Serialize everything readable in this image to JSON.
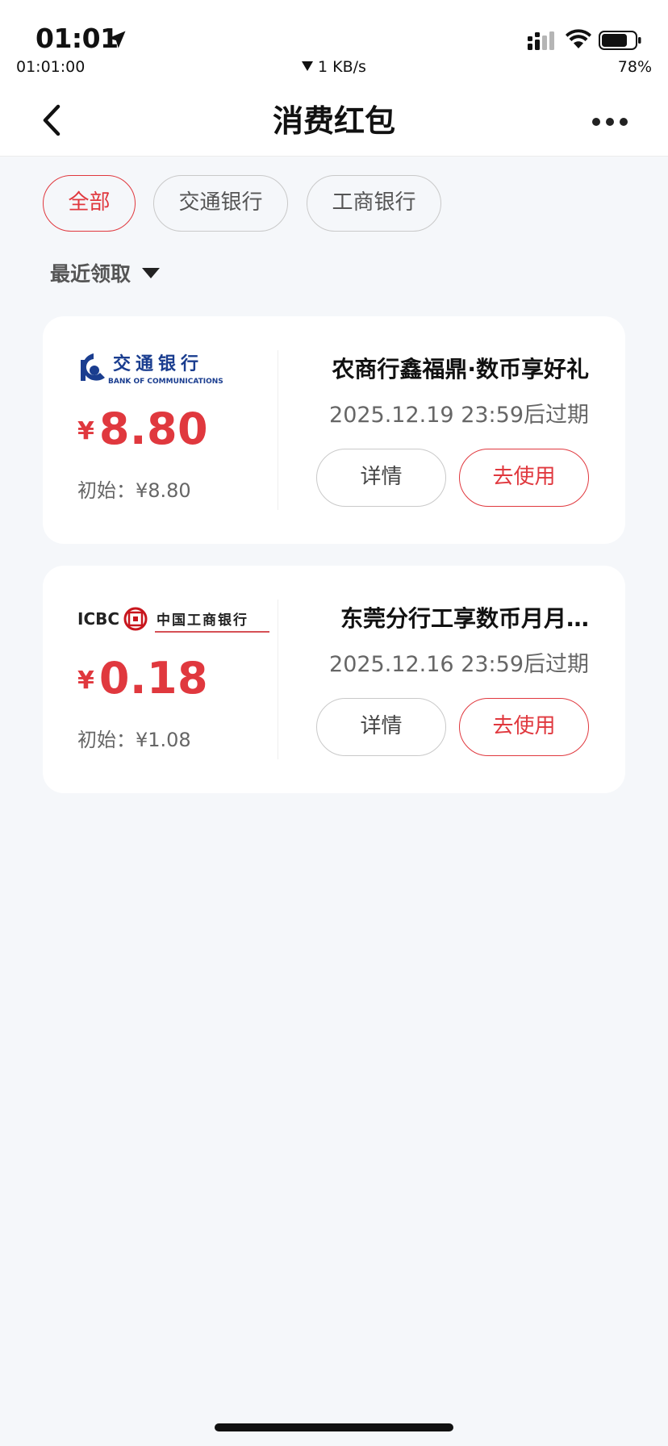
{
  "status_bar": {
    "time": "01:01",
    "sub_time": "01:01:00",
    "net_speed": "1 KB/s",
    "battery": "78%"
  },
  "nav": {
    "title": "消费红包"
  },
  "filters": [
    {
      "label": "全部",
      "active": true
    },
    {
      "label": "交通银行",
      "active": false
    },
    {
      "label": "工商银行",
      "active": false
    }
  ],
  "sort_label": "最近领取",
  "cards": [
    {
      "bank_logo": "bank-of-communications-logo",
      "logo_text_cn": "交通银行",
      "logo_text_en": "BANK OF COMMUNICATIONS",
      "currency": "¥",
      "amount": "8.80",
      "initial": "初始：¥8.80",
      "title": "农商行鑫福鼎·数币享好礼",
      "expiry": "2025.12.19 23:59后过期",
      "detail_label": "详情",
      "use_label": "去使用"
    },
    {
      "bank_logo": "icbc-logo",
      "logo_text_en": "ICBC",
      "logo_text_cn": "中国工商银行",
      "currency": "¥",
      "amount": "0.18",
      "initial": "初始：¥1.08",
      "title": "东莞分行工享数币月月…",
      "expiry": "2025.12.16 23:59后过期",
      "detail_label": "详情",
      "use_label": "去使用"
    }
  ],
  "colors": {
    "accent": "#e0383e",
    "bocom_blue": "#1a3d8f",
    "icbc_red": "#c8161d"
  }
}
